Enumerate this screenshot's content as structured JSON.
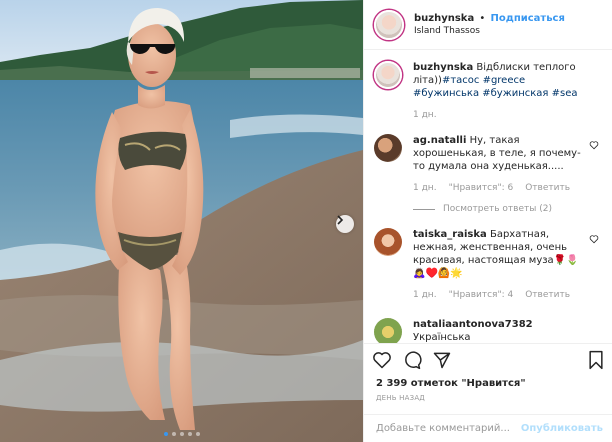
{
  "header": {
    "username": "buzhynska",
    "separator": "•",
    "follow_label": "Подписаться",
    "location": "Island Thassos"
  },
  "caption": {
    "username": "buzhynska",
    "text": "Відблиски теплого літа))",
    "tags": "#тасос #greece #бужинська #бужинская #sea",
    "time": "1 дн."
  },
  "comments": [
    {
      "username": "ag.natalli",
      "text": "Ну, такая хорошенькая, в теле, я почему-то думала она худенькая.....",
      "time": "1 дн.",
      "likes": "\"Нравится\": 6",
      "reply": "Ответить",
      "more_replies": "Посмотреть ответы (2)"
    },
    {
      "username": "taiska_raiska",
      "text": "Бархатная, нежная, женственная, очень красивая, настоящая муза🌹🌷🙇‍♀️♥️🙆🌟",
      "time": "1 дн.",
      "likes": "\"Нравится\": 4",
      "reply": "Ответить"
    },
    {
      "username": "natalia​antonova7382",
      "text": "Українська"
    }
  ],
  "actions": {
    "likes_count": "2 399 отметок \"Нравится\"",
    "date": "ДЕНЬ НАЗАД",
    "comment_placeholder": "Добавьте комментарий...",
    "publish_label": "Опубликовать"
  },
  "colors": {
    "link": "#3897f0",
    "tag": "#003569",
    "muted": "#999999",
    "publish_disabled": "#b2dffc"
  },
  "carousel": {
    "total_slides": 5,
    "active_slide": 1
  }
}
